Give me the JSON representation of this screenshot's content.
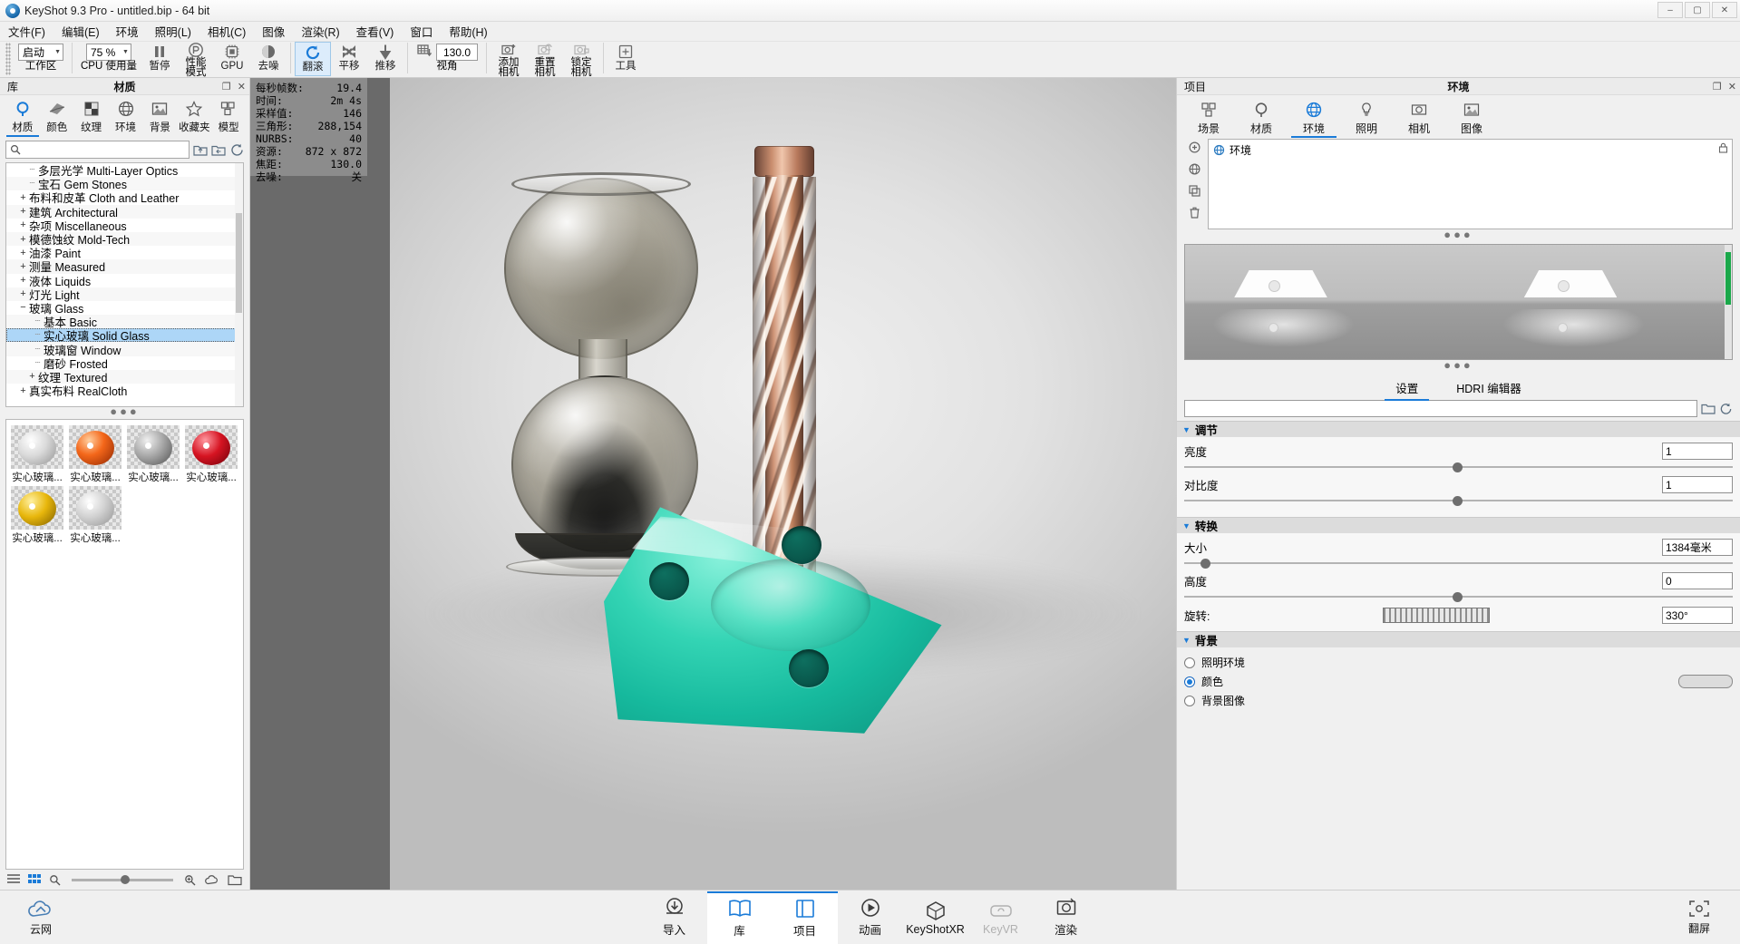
{
  "window": {
    "title": "KeyShot 9.3 Pro  - untitled.bip  - 64 bit",
    "minimize": "–",
    "maximize": "▢",
    "close": "✕"
  },
  "menubar": {
    "items": [
      {
        "label": "文件(F)"
      },
      {
        "label": "编辑(E)"
      },
      {
        "label": "环境"
      },
      {
        "label": "照明(L)"
      },
      {
        "label": "相机(C)"
      },
      {
        "label": "图像"
      },
      {
        "label": "渲染(R)"
      },
      {
        "label": "查看(V)"
      },
      {
        "label": "窗口"
      },
      {
        "label": "帮助(H)"
      }
    ]
  },
  "toolbar": {
    "workspace_value": "启动",
    "workspace_label": "工作区",
    "cpu_value": "75 %",
    "cpu_label": "CPU 使用量",
    "pause_label": "暂停",
    "perf_label_1": "性能",
    "perf_label_2": "模式",
    "gpu_label": "GPU",
    "denoise_label": "去噪",
    "rollover_label": "翻滚",
    "pan_label": "平移",
    "dolly_label": "推移",
    "fov_value": "130.0",
    "fov_label": "视角",
    "addcam_label_1": "添加",
    "addcam_label_2": "相机",
    "resetcam_label_1": "重置",
    "resetcam_label_2": "相机",
    "lockcam_label_1": "锁定",
    "lockcam_label_2": "相机",
    "tools_label": "工具"
  },
  "library": {
    "tab_left": "库",
    "tab_center": "材质",
    "restore_icon": "❐",
    "close_icon": "✕",
    "tabs": [
      {
        "label": "材质",
        "icon": "material-icon",
        "active": true
      },
      {
        "label": "颜色",
        "icon": "color-icon",
        "active": false
      },
      {
        "label": "纹理",
        "icon": "texture-icon",
        "active": false
      },
      {
        "label": "环境",
        "icon": "environment-icon",
        "active": false
      },
      {
        "label": "背景",
        "icon": "background-icon",
        "active": false
      },
      {
        "label": "收藏夹",
        "icon": "star-icon",
        "active": false
      },
      {
        "label": "模型",
        "icon": "model-icon",
        "active": false
      }
    ],
    "search_placeholder": "",
    "search_value": "",
    "tree": [
      {
        "label": "多层光学 Multi-Layer Optics",
        "expander": "dash",
        "depth": 1,
        "selected": false
      },
      {
        "label": "宝石 Gem Stones",
        "expander": "dash",
        "depth": 1,
        "selected": false
      },
      {
        "label": "布料和皮革 Cloth and Leather",
        "expander": "+",
        "depth": 0,
        "selected": false
      },
      {
        "label": "建筑 Architectural",
        "expander": "+",
        "depth": 0,
        "selected": false
      },
      {
        "label": "杂项 Miscellaneous",
        "expander": "+",
        "depth": 0,
        "selected": false
      },
      {
        "label": "模德蚀纹 Mold-Tech",
        "expander": "+",
        "depth": 0,
        "selected": false
      },
      {
        "label": "油漆 Paint",
        "expander": "+",
        "depth": 0,
        "selected": false
      },
      {
        "label": "测量 Measured",
        "expander": "+",
        "depth": 0,
        "selected": false
      },
      {
        "label": "液体 Liquids",
        "expander": "+",
        "depth": 0,
        "selected": false
      },
      {
        "label": "灯光 Light",
        "expander": "+",
        "depth": 0,
        "selected": false
      },
      {
        "label": "玻璃 Glass",
        "expander": "−",
        "depth": 0,
        "selected": false
      },
      {
        "label": "基本 Basic",
        "expander": "dash",
        "depth": 1,
        "selected": false
      },
      {
        "label": "实心玻璃 Solid Glass",
        "expander": "dash",
        "depth": 1,
        "selected": true
      },
      {
        "label": "玻璃窗 Window",
        "expander": "dash",
        "depth": 1,
        "selected": false
      },
      {
        "label": "磨砂 Frosted",
        "expander": "dash",
        "depth": 1,
        "selected": false
      },
      {
        "label": "纹理 Textured",
        "expander": "+",
        "depth": 1,
        "selected": false
      },
      {
        "label": "真实布料 RealCloth",
        "expander": "+",
        "depth": 0,
        "selected": false
      }
    ],
    "thumbnails": [
      {
        "caption": "实心玻璃...",
        "color": "#d7d7d7"
      },
      {
        "caption": "实心玻璃...",
        "color": "#e8571a"
      },
      {
        "caption": "实心玻璃...",
        "color": "#9a9a9a"
      },
      {
        "caption": "实心玻璃...",
        "color": "#d61422"
      },
      {
        "caption": "实心玻璃...",
        "color": "#e3b70c"
      },
      {
        "caption": "实心玻璃...",
        "color": "#c8c8c8"
      }
    ],
    "footer_icons": [
      "list-view-icon",
      "grid-view-icon",
      "search-small-icon",
      "zoom-slider",
      "zoom-in-icon",
      "cloud-icon",
      "folder-icon"
    ]
  },
  "stats": {
    "rows": [
      {
        "key": "每秒帧数:",
        "value": "19.4"
      },
      {
        "key": "时间:",
        "value": "2m 4s"
      },
      {
        "key": "采样值:",
        "value": "146"
      },
      {
        "key": "三角形:",
        "value": "288,154"
      },
      {
        "key": "NURBS:",
        "value": "40"
      },
      {
        "key": "资源:",
        "value": "872 x 872"
      },
      {
        "key": "焦距:",
        "value": "130.0"
      },
      {
        "key": "去噪:",
        "value": "关"
      }
    ]
  },
  "right_panel": {
    "tab_left": "项目",
    "tab_center": "环境",
    "restore_icon": "❐",
    "close_icon": "✕",
    "tabs": [
      {
        "label": "场景",
        "icon": "scene-icon",
        "active": false
      },
      {
        "label": "材质",
        "icon": "material-icon",
        "active": false
      },
      {
        "label": "环境",
        "icon": "environment-icon",
        "active": true
      },
      {
        "label": "照明",
        "icon": "lighting-icon",
        "active": false
      },
      {
        "label": "相机",
        "icon": "camera-icon",
        "active": false
      },
      {
        "label": "图像",
        "icon": "image-icon",
        "active": false
      }
    ],
    "side_tools": [
      "add-environment-icon",
      "globe-icon",
      "duplicate-icon",
      "trash-icon"
    ],
    "env_list": [
      {
        "label": "环境",
        "icon": "globe-icon"
      }
    ],
    "lock_icon": "🔒",
    "setting_tabs": [
      {
        "label": "设置",
        "active": true
      },
      {
        "label": "HDRI 编辑器",
        "active": false
      }
    ],
    "url_value": "",
    "folder_icon": "📂",
    "refresh_icon": "↻",
    "sections": [
      {
        "title": "调节",
        "fields": [
          {
            "label": "亮度",
            "value": "1",
            "slider": 50
          },
          {
            "label": "对比度",
            "value": "1",
            "slider": 50
          }
        ]
      },
      {
        "title": "转换",
        "fields": [
          {
            "label": "大小",
            "value": "1384毫米",
            "slider": 4
          },
          {
            "label": "高度",
            "value": "0",
            "slider": 50
          },
          {
            "label": "旋转:",
            "value": "330°",
            "dial": true
          }
        ]
      }
    ],
    "background": {
      "title": "背景",
      "options": [
        {
          "label": "照明环境",
          "selected": false
        },
        {
          "label": "颜色",
          "selected": true,
          "swatch": "#dcdcdc"
        },
        {
          "label": "背景图像",
          "selected": false
        }
      ]
    }
  },
  "bottombar": {
    "cloud_label": "云网",
    "buttons": [
      {
        "label": "导入",
        "icon": "import-icon",
        "active": false,
        "dim": false
      },
      {
        "label": "库",
        "icon": "library-icon",
        "active": true,
        "dim": false
      },
      {
        "label": "项目",
        "icon": "project-icon",
        "active": true,
        "dim": false
      },
      {
        "label": "动画",
        "icon": "animation-icon",
        "active": false,
        "dim": false
      },
      {
        "label": "KeyShotXR",
        "icon": "keyshotxr-icon",
        "active": false,
        "dim": false
      },
      {
        "label": "KeyVR",
        "icon": "keyvr-icon",
        "active": false,
        "dim": true
      },
      {
        "label": "渲染",
        "icon": "render-icon",
        "active": false,
        "dim": false
      }
    ],
    "fullscreen_label": "翻屏"
  },
  "colors": {
    "accent": "#1a7bd8",
    "selection": "#add6f7",
    "bracket_teal": "#1fc9ab",
    "copper": "#c98d6e"
  }
}
